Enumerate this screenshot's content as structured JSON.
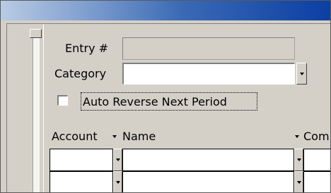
{
  "form": {
    "entry_label": "Entry #",
    "entry_value": "",
    "category_label": "Category",
    "category_value": "",
    "auto_reverse_label": "Auto Reverse Next Period",
    "auto_reverse_checked": false
  },
  "grid": {
    "columns": [
      "Account",
      "Name",
      "Com"
    ]
  },
  "icons": {
    "dropdown": "chevron-down-icon"
  }
}
